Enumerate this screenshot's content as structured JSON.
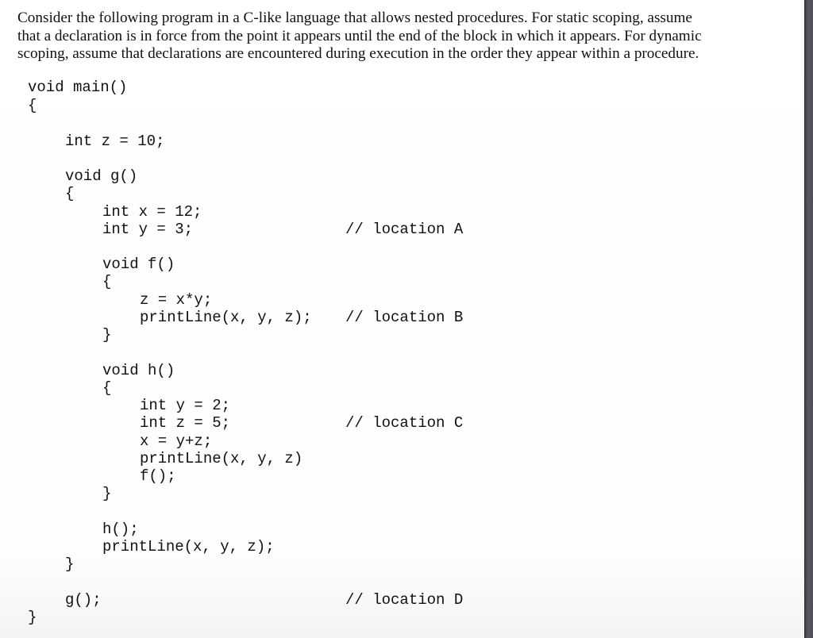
{
  "question": {
    "intro_lines": [
      "Consider the following program in a C-like language that allows nested procedures. For static scoping, assume",
      "that a declaration is in force from the point it appears until the end of the block in which it appears. For dynamic",
      "scoping, assume that declarations are encountered during execution in the order they appear within a procedure."
    ]
  },
  "code": {
    "lines": [
      {
        "indent": 0,
        "text": "void main()"
      },
      {
        "indent": 0,
        "text": "{"
      },
      {
        "indent": 1,
        "text": "int z = 10;"
      },
      {
        "indent": 1,
        "text": "void g()"
      },
      {
        "indent": 1,
        "text": "{"
      },
      {
        "indent": 2,
        "text": "int x = 12;"
      },
      {
        "indent": 2,
        "text": "int y = 3;"
      },
      {
        "indent": 2,
        "text": "void f()"
      },
      {
        "indent": 2,
        "text": "{"
      },
      {
        "indent": 3,
        "text": "z = x*y;"
      },
      {
        "indent": 3,
        "text": "printLine(x, y, z);"
      },
      {
        "indent": 2,
        "text": "}"
      },
      {
        "indent": 2,
        "text": "void h()"
      },
      {
        "indent": 2,
        "text": "{"
      },
      {
        "indent": 3,
        "text": "int y = 2;"
      },
      {
        "indent": 3,
        "text": "int z = 5;"
      },
      {
        "indent": 3,
        "text": "x = y+z;"
      },
      {
        "indent": 3,
        "text": "printLine(x, y, z)"
      },
      {
        "indent": 3,
        "text": "f();"
      },
      {
        "indent": 2,
        "text": "}"
      },
      {
        "indent": 2,
        "text": "h();"
      },
      {
        "indent": 2,
        "text": "printLine(x, y, z);"
      },
      {
        "indent": 1,
        "text": "}"
      },
      {
        "indent": 1,
        "text": "g();"
      },
      {
        "indent": 0,
        "text": "}"
      }
    ],
    "comments": [
      {
        "line_index": 6,
        "text": "// location A"
      },
      {
        "line_index": 10,
        "text": "// location B"
      },
      {
        "line_index": 15,
        "text": "// location C"
      },
      {
        "line_index": 23,
        "text": "// location D"
      }
    ]
  }
}
